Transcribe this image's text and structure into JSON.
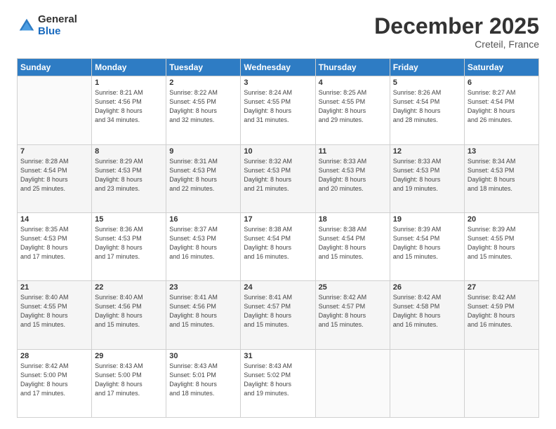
{
  "logo": {
    "general": "General",
    "blue": "Blue"
  },
  "header": {
    "month": "December 2025",
    "location": "Creteil, France"
  },
  "weekdays": [
    "Sunday",
    "Monday",
    "Tuesday",
    "Wednesday",
    "Thursday",
    "Friday",
    "Saturday"
  ],
  "weeks": [
    [
      {
        "day": null,
        "sunrise": null,
        "sunset": null,
        "daylight": null
      },
      {
        "day": "1",
        "sunrise": "Sunrise: 8:21 AM",
        "sunset": "Sunset: 4:56 PM",
        "daylight": "Daylight: 8 hours and 34 minutes."
      },
      {
        "day": "2",
        "sunrise": "Sunrise: 8:22 AM",
        "sunset": "Sunset: 4:55 PM",
        "daylight": "Daylight: 8 hours and 32 minutes."
      },
      {
        "day": "3",
        "sunrise": "Sunrise: 8:24 AM",
        "sunset": "Sunset: 4:55 PM",
        "daylight": "Daylight: 8 hours and 31 minutes."
      },
      {
        "day": "4",
        "sunrise": "Sunrise: 8:25 AM",
        "sunset": "Sunset: 4:55 PM",
        "daylight": "Daylight: 8 hours and 29 minutes."
      },
      {
        "day": "5",
        "sunrise": "Sunrise: 8:26 AM",
        "sunset": "Sunset: 4:54 PM",
        "daylight": "Daylight: 8 hours and 28 minutes."
      },
      {
        "day": "6",
        "sunrise": "Sunrise: 8:27 AM",
        "sunset": "Sunset: 4:54 PM",
        "daylight": "Daylight: 8 hours and 26 minutes."
      }
    ],
    [
      {
        "day": "7",
        "sunrise": "Sunrise: 8:28 AM",
        "sunset": "Sunset: 4:54 PM",
        "daylight": "Daylight: 8 hours and 25 minutes."
      },
      {
        "day": "8",
        "sunrise": "Sunrise: 8:29 AM",
        "sunset": "Sunset: 4:53 PM",
        "daylight": "Daylight: 8 hours and 23 minutes."
      },
      {
        "day": "9",
        "sunrise": "Sunrise: 8:31 AM",
        "sunset": "Sunset: 4:53 PM",
        "daylight": "Daylight: 8 hours and 22 minutes."
      },
      {
        "day": "10",
        "sunrise": "Sunrise: 8:32 AM",
        "sunset": "Sunset: 4:53 PM",
        "daylight": "Daylight: 8 hours and 21 minutes."
      },
      {
        "day": "11",
        "sunrise": "Sunrise: 8:33 AM",
        "sunset": "Sunset: 4:53 PM",
        "daylight": "Daylight: 8 hours and 20 minutes."
      },
      {
        "day": "12",
        "sunrise": "Sunrise: 8:33 AM",
        "sunset": "Sunset: 4:53 PM",
        "daylight": "Daylight: 8 hours and 19 minutes."
      },
      {
        "day": "13",
        "sunrise": "Sunrise: 8:34 AM",
        "sunset": "Sunset: 4:53 PM",
        "daylight": "Daylight: 8 hours and 18 minutes."
      }
    ],
    [
      {
        "day": "14",
        "sunrise": "Sunrise: 8:35 AM",
        "sunset": "Sunset: 4:53 PM",
        "daylight": "Daylight: 8 hours and 17 minutes."
      },
      {
        "day": "15",
        "sunrise": "Sunrise: 8:36 AM",
        "sunset": "Sunset: 4:53 PM",
        "daylight": "Daylight: 8 hours and 17 minutes."
      },
      {
        "day": "16",
        "sunrise": "Sunrise: 8:37 AM",
        "sunset": "Sunset: 4:53 PM",
        "daylight": "Daylight: 8 hours and 16 minutes."
      },
      {
        "day": "17",
        "sunrise": "Sunrise: 8:38 AM",
        "sunset": "Sunset: 4:54 PM",
        "daylight": "Daylight: 8 hours and 16 minutes."
      },
      {
        "day": "18",
        "sunrise": "Sunrise: 8:38 AM",
        "sunset": "Sunset: 4:54 PM",
        "daylight": "Daylight: 8 hours and 15 minutes."
      },
      {
        "day": "19",
        "sunrise": "Sunrise: 8:39 AM",
        "sunset": "Sunset: 4:54 PM",
        "daylight": "Daylight: 8 hours and 15 minutes."
      },
      {
        "day": "20",
        "sunrise": "Sunrise: 8:39 AM",
        "sunset": "Sunset: 4:55 PM",
        "daylight": "Daylight: 8 hours and 15 minutes."
      }
    ],
    [
      {
        "day": "21",
        "sunrise": "Sunrise: 8:40 AM",
        "sunset": "Sunset: 4:55 PM",
        "daylight": "Daylight: 8 hours and 15 minutes."
      },
      {
        "day": "22",
        "sunrise": "Sunrise: 8:40 AM",
        "sunset": "Sunset: 4:56 PM",
        "daylight": "Daylight: 8 hours and 15 minutes."
      },
      {
        "day": "23",
        "sunrise": "Sunrise: 8:41 AM",
        "sunset": "Sunset: 4:56 PM",
        "daylight": "Daylight: 8 hours and 15 minutes."
      },
      {
        "day": "24",
        "sunrise": "Sunrise: 8:41 AM",
        "sunset": "Sunset: 4:57 PM",
        "daylight": "Daylight: 8 hours and 15 minutes."
      },
      {
        "day": "25",
        "sunrise": "Sunrise: 8:42 AM",
        "sunset": "Sunset: 4:57 PM",
        "daylight": "Daylight: 8 hours and 15 minutes."
      },
      {
        "day": "26",
        "sunrise": "Sunrise: 8:42 AM",
        "sunset": "Sunset: 4:58 PM",
        "daylight": "Daylight: 8 hours and 16 minutes."
      },
      {
        "day": "27",
        "sunrise": "Sunrise: 8:42 AM",
        "sunset": "Sunset: 4:59 PM",
        "daylight": "Daylight: 8 hours and 16 minutes."
      }
    ],
    [
      {
        "day": "28",
        "sunrise": "Sunrise: 8:42 AM",
        "sunset": "Sunset: 5:00 PM",
        "daylight": "Daylight: 8 hours and 17 minutes."
      },
      {
        "day": "29",
        "sunrise": "Sunrise: 8:43 AM",
        "sunset": "Sunset: 5:00 PM",
        "daylight": "Daylight: 8 hours and 17 minutes."
      },
      {
        "day": "30",
        "sunrise": "Sunrise: 8:43 AM",
        "sunset": "Sunset: 5:01 PM",
        "daylight": "Daylight: 8 hours and 18 minutes."
      },
      {
        "day": "31",
        "sunrise": "Sunrise: 8:43 AM",
        "sunset": "Sunset: 5:02 PM",
        "daylight": "Daylight: 8 hours and 19 minutes."
      },
      {
        "day": null,
        "sunrise": null,
        "sunset": null,
        "daylight": null
      },
      {
        "day": null,
        "sunrise": null,
        "sunset": null,
        "daylight": null
      },
      {
        "day": null,
        "sunrise": null,
        "sunset": null,
        "daylight": null
      }
    ]
  ]
}
